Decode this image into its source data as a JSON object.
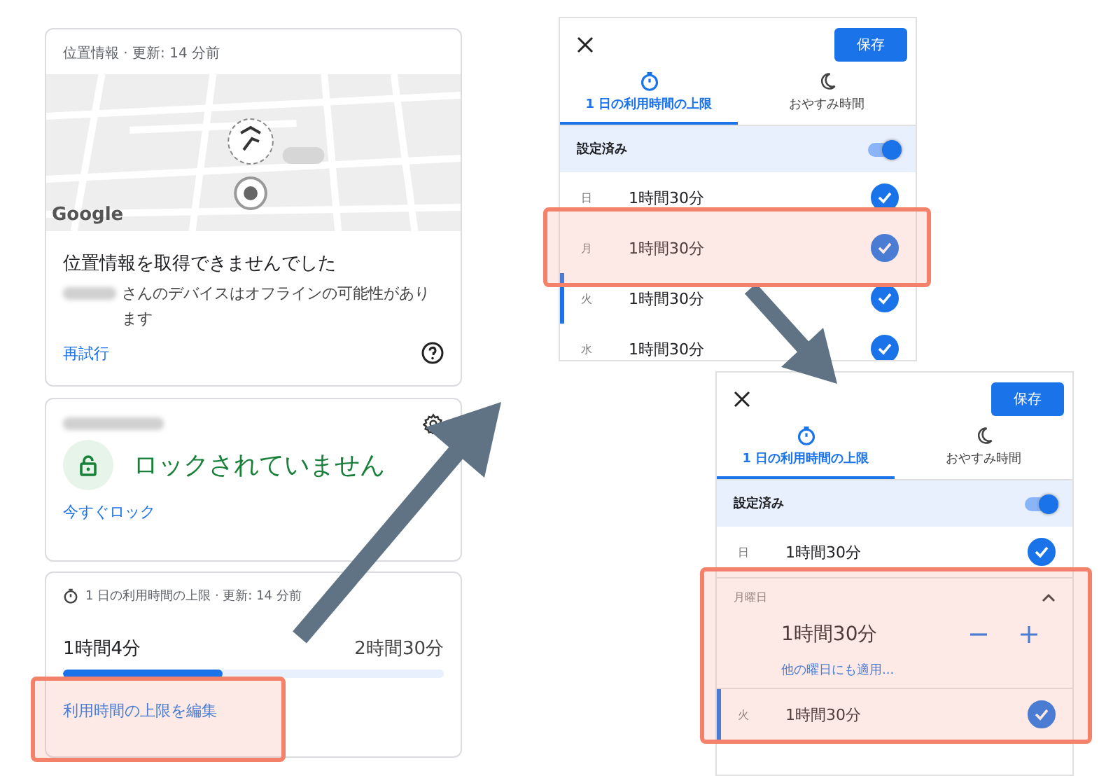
{
  "location_card": {
    "header": "位置情報 · 更新: 14 分前",
    "map_logo": "Google",
    "title": "位置情報を取得できませんでした",
    "message": "さんのデバイスはオフラインの可能性があります",
    "retry": "再試行"
  },
  "lock_card": {
    "locked": false,
    "status": "ロックされていません",
    "action": "今すぐロック"
  },
  "limit_card": {
    "header": "1 日の利用時間の上限 · 更新: 14 分前",
    "used": "1時間4分",
    "limit": "2時間30分",
    "level": 0.42,
    "edit": "利用時間の上限を編集"
  },
  "panels": [
    {
      "save": "保存",
      "tabs": [
        {
          "label": "1 日の利用時間の上限",
          "kind": "timer",
          "selected": true
        },
        {
          "label": "おやすみ時間",
          "kind": "moon",
          "selected": false
        }
      ],
      "enabled_label": "設定済み",
      "enabled": true,
      "days": [
        {
          "kind": "row",
          "day": "日",
          "time": "1時間30分",
          "checked": true,
          "marker": false
        },
        {
          "kind": "row",
          "day": "月",
          "time": "1時間30分",
          "checked": true,
          "marker": false
        },
        {
          "kind": "row",
          "day": "火",
          "time": "1時間30分",
          "checked": true,
          "marker": true
        },
        {
          "kind": "row",
          "day": "水",
          "time": "1時間30分",
          "checked": true,
          "marker": false
        }
      ]
    },
    {
      "save": "保存",
      "tabs": [
        {
          "label": "1 日の利用時間の上限",
          "kind": "timer",
          "selected": true
        },
        {
          "label": "おやすみ時間",
          "kind": "moon",
          "selected": false
        }
      ],
      "enabled_label": "設定済み",
      "enabled": true,
      "days": [
        {
          "kind": "row",
          "day": "日",
          "time": "1時間30分",
          "checked": true,
          "marker": false
        },
        {
          "kind": "expanded",
          "day": "月曜日",
          "time": "1時間30分",
          "apply": "他の曜日にも適用..."
        },
        {
          "kind": "row",
          "day": "火",
          "time": "1時間30分",
          "checked": true,
          "marker": true
        }
      ]
    }
  ]
}
